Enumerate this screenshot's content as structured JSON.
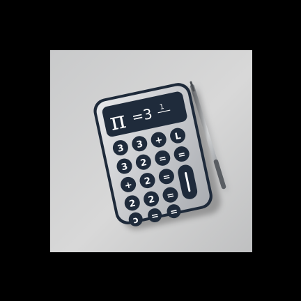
{
  "scene": {
    "background_color": "#000000",
    "surface_color": "#d0d0d0",
    "calculator": {
      "body_color": "#c7c9cc",
      "bezel_color": "#1e2a3a",
      "display_color": "#1f2b3b",
      "display": {
        "pi_symbol": "π",
        "equation": "=3",
        "fraction": "1"
      },
      "keys": [
        {
          "label": "3"
        },
        {
          "label": "3"
        },
        {
          "label": "+"
        },
        {
          "label": "L"
        },
        {
          "label": "3"
        },
        {
          "label": "2"
        },
        {
          "label": "="
        },
        {
          "label": "="
        },
        {
          "label": "+"
        },
        {
          "label": "2"
        },
        {
          "label": "="
        },
        {
          "label": ""
        },
        {
          "label": "2"
        },
        {
          "label": "2"
        },
        {
          "label": "="
        },
        {
          "label": "ɔ"
        },
        {
          "label": "="
        },
        {
          "label": "="
        }
      ],
      "key_color": "#1f2b3b",
      "key_text_color": "#ffffff"
    },
    "pen": {
      "body_color": "#9a9ea3",
      "tip_color": "#4a4e53"
    }
  }
}
